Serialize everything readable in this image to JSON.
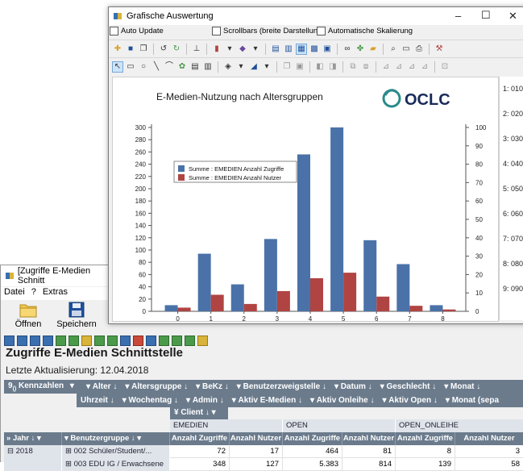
{
  "back_window": {
    "title": "[Zugriffe E-Medien Schnitt",
    "menu": [
      "Datei",
      "?",
      "Extras"
    ],
    "buttons": {
      "open": "Öffnen",
      "save": "Speichern"
    },
    "heading": "Zugriffe E-Medien Schnittstelle",
    "last_update": "Letzte Aktualisierung:  12.04.2018",
    "pivot_row1": [
      "Kennzahlen",
      "Alter",
      "Altersgruppe",
      "BeKz",
      "Benutzerzweigstelle",
      "Datum",
      "Geschlecht",
      "Monat"
    ],
    "pivot_row2": [
      "Uhrzeit",
      "Wochentag",
      "Admin",
      "Aktiv E-Medien",
      "Aktiv Onleihe",
      "Aktiv Open",
      "Monat (sepa"
    ],
    "client_label": "Client",
    "table": {
      "groups": [
        "EMEDIEN",
        "OPEN",
        "OPEN_ONLEIHE"
      ],
      "col_labels": [
        "Anzahl Zugriffe",
        "Anzahl Nutzer",
        "Anzahl Zugriffe",
        "Anzahl Nutzer",
        "Anzahl Zugriffe",
        "Anzahl Nutzer"
      ],
      "row_headers": {
        "year": "Jahr",
        "group": "Benutzergruppe"
      },
      "rows": [
        {
          "year": "2018",
          "group": "002 Schüler/Student/...",
          "values": [
            "72",
            "17",
            "464",
            "81",
            "8",
            "3"
          ]
        },
        {
          "year": "",
          "group": "003 EDU IG / Erwachsene",
          "values": [
            "348",
            "127",
            "5.383",
            "814",
            "139",
            "58"
          ]
        }
      ]
    }
  },
  "front_window": {
    "title": "Grafische Auswertung",
    "checkboxes": [
      "Auto Update",
      "Scrollbars (breite Darstellung)",
      "Automatische Skalierung"
    ],
    "logo_text": "OCLC",
    "right_list": [
      "1: 010",
      "2: 020",
      "3: 030",
      "4: 040",
      "5: 050",
      "6: 060",
      "7: 070",
      "8: 080",
      "9: 090"
    ]
  },
  "colors": {
    "series1": "#4a72a8",
    "series2": "#b04442"
  },
  "chart_data": {
    "type": "bar",
    "title": "E-Medien-Nutzung nach Altersgruppen",
    "categories": [
      "0",
      "1",
      "2",
      "3",
      "4",
      "5",
      "6",
      "7",
      "8"
    ],
    "series": [
      {
        "name": "Summe : EMEDIEN Anzahl Zugriffe",
        "axis": "left",
        "values": [
          10,
          94,
          44,
          118,
          256,
          300,
          116,
          77,
          10
        ]
      },
      {
        "name": "Summe : EMEDIEN Anzahl Nutzer",
        "axis": "right",
        "values": [
          2,
          9,
          4,
          11,
          18,
          21,
          8,
          3,
          1
        ]
      }
    ],
    "ylim_left": [
      0,
      300
    ],
    "ylim_right": [
      0,
      100
    ],
    "left_ticks": [
      0,
      20,
      40,
      60,
      80,
      100,
      120,
      140,
      160,
      180,
      200,
      220,
      240,
      260,
      280,
      300
    ],
    "right_ticks": [
      0,
      10,
      20,
      30,
      40,
      50,
      60,
      70,
      80,
      90,
      100
    ],
    "legend_position": "top-left",
    "grid": false
  }
}
